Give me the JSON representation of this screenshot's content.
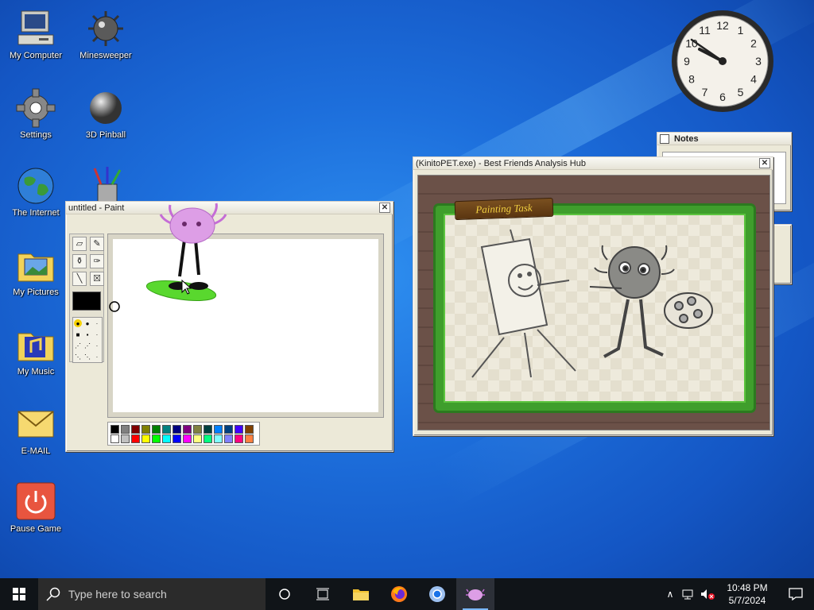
{
  "desktop": {
    "icons": [
      {
        "label": "My Computer"
      },
      {
        "label": "Minesweeper"
      },
      {
        "label": "Settings"
      },
      {
        "label": "3D Pinball"
      },
      {
        "label": "The Internet"
      },
      {
        "label": "My Pictures"
      },
      {
        "label": "My Music"
      },
      {
        "label": "E-MAIL"
      },
      {
        "label": "Pause Game"
      }
    ]
  },
  "clock": {
    "numbers": [
      "12",
      "1",
      "2",
      "3",
      "4",
      "5",
      "6",
      "7",
      "8",
      "9",
      "10",
      "11"
    ]
  },
  "notes_window": {
    "title": "Notes"
  },
  "paint_window": {
    "title": "untitled - Paint",
    "palette_top": [
      "#000000",
      "#808080",
      "#800000",
      "#808000",
      "#008000",
      "#008080",
      "#000080",
      "#800080",
      "#808040",
      "#004040",
      "#0080ff",
      "#004080",
      "#4000ff",
      "#804000"
    ],
    "palette_bottom": [
      "#ffffff",
      "#c0c0c0",
      "#ff0000",
      "#ffff00",
      "#00ff00",
      "#00ffff",
      "#0000ff",
      "#ff00ff",
      "#ffff80",
      "#00ff80",
      "#80ffff",
      "#8080ff",
      "#ff0080",
      "#ff8040"
    ]
  },
  "kinito_window": {
    "title": "(KinitoPET.exe) - Best Friends Analysis Hub",
    "banner": "Painting Task"
  },
  "taskbar": {
    "search_placeholder": "Type here to search",
    "time": "10:48 PM",
    "date": "5/7/2024"
  },
  "colors": {
    "accent": "#1d6fdc",
    "taskbar": "#101418"
  }
}
